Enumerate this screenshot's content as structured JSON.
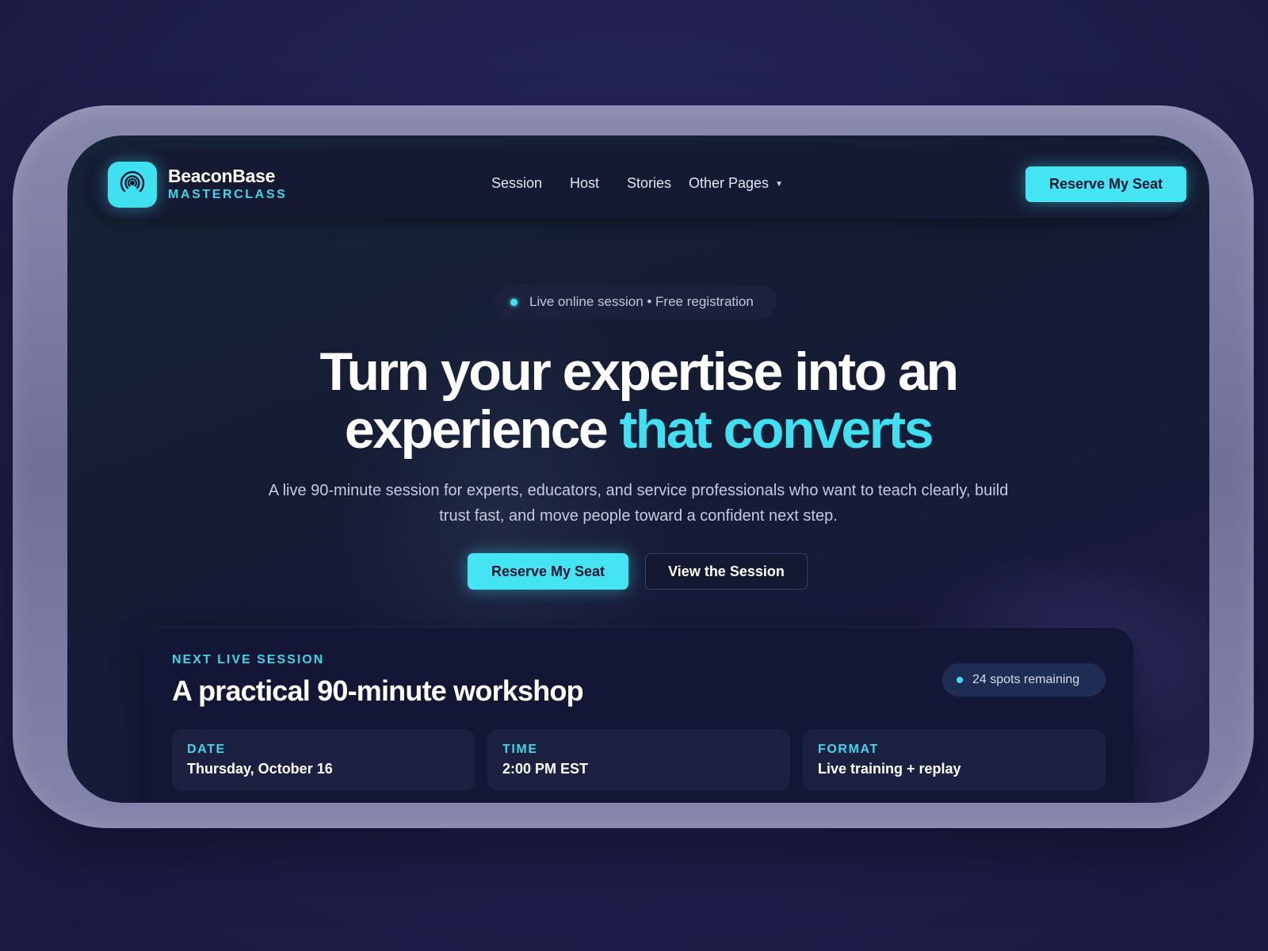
{
  "brand": {
    "name": "BeaconBase",
    "subtitle": "MASTERCLASS",
    "logo_icon": "broadcast-icon",
    "accent_color": "#3fe0f0"
  },
  "nav": {
    "links": [
      "Session",
      "Host",
      "Stories",
      "Other Pages"
    ],
    "dropdown_icon": "caret-down-icon",
    "cta_label": "Reserve My Seat"
  },
  "hero": {
    "pill_text": "Live online session • Free registration",
    "headline_line1": "Turn your expertise into an",
    "headline_line2_plain": "experience",
    "headline_line2_accent": "that converts",
    "description": "A live 90-minute session for experts, educators, and service professionals who want to teach clearly, build trust fast, and move people toward a confident next step.",
    "primary_cta": "Reserve My Seat",
    "secondary_cta": "View the Session"
  },
  "session_card": {
    "kicker": "NEXT LIVE SESSION",
    "title": "A practical 90-minute workshop",
    "spots_badge": "24 spots remaining",
    "details": [
      {
        "label": "DATE",
        "value": "Thursday, October 16"
      },
      {
        "label": "TIME",
        "value": "2:00 PM EST"
      },
      {
        "label": "FORMAT",
        "value": "Live training + replay"
      }
    ]
  }
}
